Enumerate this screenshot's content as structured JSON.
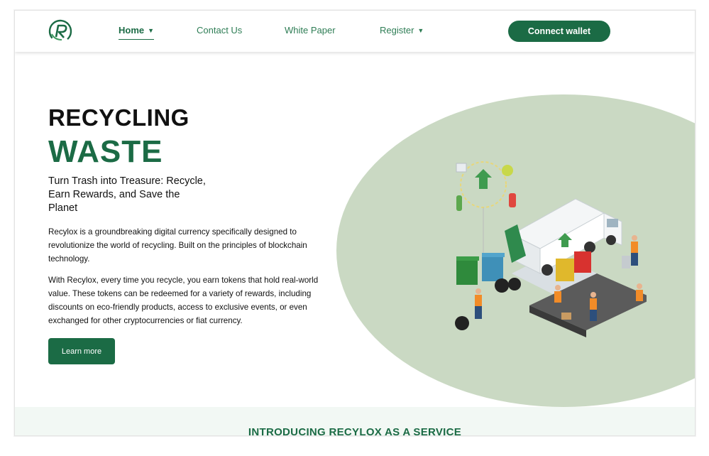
{
  "nav": {
    "items": [
      {
        "label": "Home",
        "active": true,
        "caret": true
      },
      {
        "label": "Contact Us",
        "active": false,
        "caret": false
      },
      {
        "label": "White Paper",
        "active": false,
        "caret": false
      },
      {
        "label": "Register",
        "active": false,
        "caret": true
      }
    ],
    "cta_label": "Connect wallet"
  },
  "hero": {
    "title_line1": "RECYCLING",
    "title_line2": "WASTE",
    "subtitle": "Turn Trash into Treasure: Recycle, Earn Rewards, and Save the Planet",
    "paragraph1": "Recylox is a groundbreaking digital currency specifically designed to revolutionize the world of recycling. Built on the principles of blockchain technology.",
    "paragraph2": "With Recylox, every time you recycle, you earn tokens that hold real-world value. These tokens can be redeemed for a variety of rewards, including discounts on eco-friendly products, access to exclusive events, or even exchanged for other cryptocurrencies or fiat currency.",
    "button_label": "Learn more"
  },
  "section": {
    "title": "INTRODUCING RECYLOX AS A SERVICE"
  },
  "colors": {
    "brand": "#1b6b45",
    "blob": "#cad9c3",
    "strip": "#f2f8f4"
  }
}
